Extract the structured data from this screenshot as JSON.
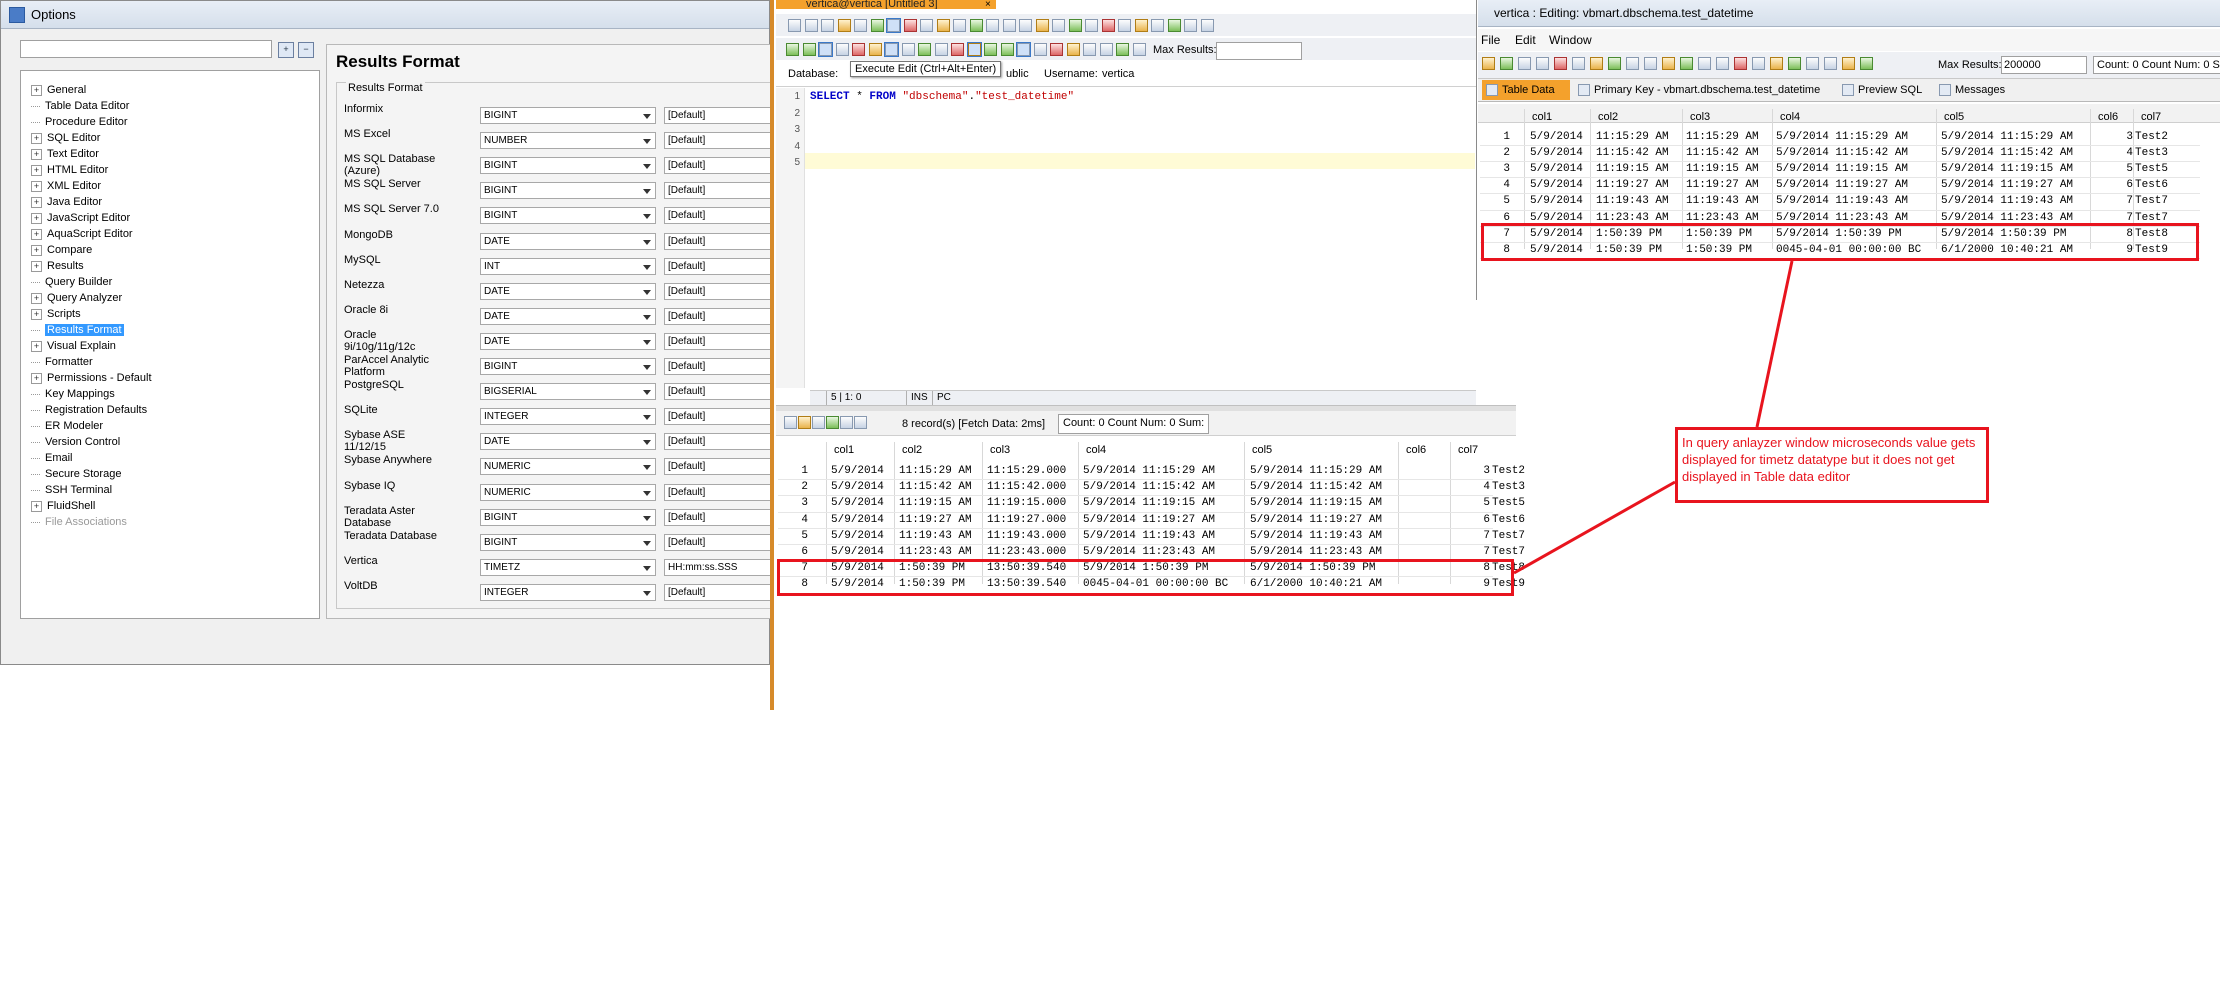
{
  "options_window": {
    "title": "Options",
    "tree": [
      {
        "label": "General",
        "expandable": true
      },
      {
        "label": "Table Data Editor",
        "expandable": false
      },
      {
        "label": "Procedure Editor",
        "expandable": false
      },
      {
        "label": "SQL Editor",
        "expandable": true
      },
      {
        "label": "Text Editor",
        "expandable": true
      },
      {
        "label": "HTML Editor",
        "expandable": true
      },
      {
        "label": "XML Editor",
        "expandable": true
      },
      {
        "label": "Java Editor",
        "expandable": true
      },
      {
        "label": "JavaScript Editor",
        "expandable": true
      },
      {
        "label": "AquaScript Editor",
        "expandable": true
      },
      {
        "label": "Compare",
        "expandable": true
      },
      {
        "label": "Results",
        "expandable": true
      },
      {
        "label": "Query Builder",
        "expandable": false
      },
      {
        "label": "Query Analyzer",
        "expandable": true
      },
      {
        "label": "Scripts",
        "expandable": true
      },
      {
        "label": "Results Format",
        "expandable": false,
        "selected": true
      },
      {
        "label": "Visual Explain",
        "expandable": true
      },
      {
        "label": "Formatter",
        "expandable": false
      },
      {
        "label": "Permissions - Default",
        "expandable": true
      },
      {
        "label": "Key Mappings",
        "expandable": false
      },
      {
        "label": "Registration Defaults",
        "expandable": false
      },
      {
        "label": "ER Modeler",
        "expandable": false
      },
      {
        "label": "Version Control",
        "expandable": false
      },
      {
        "label": "Email",
        "expandable": false
      },
      {
        "label": "Secure Storage",
        "expandable": false
      },
      {
        "label": "SSH Terminal",
        "expandable": false
      },
      {
        "label": "FluidShell",
        "expandable": true
      },
      {
        "label": "File Associations",
        "expandable": false,
        "disabled": true
      }
    ],
    "panel_title": "Results Format",
    "group_label": "Results Format",
    "rows": [
      {
        "name": "Informix",
        "type": "BIGINT",
        "format": "[Default]"
      },
      {
        "name": "MS Excel",
        "type": "NUMBER",
        "format": "[Default]"
      },
      {
        "name": "MS SQL Database (Azure)",
        "type": "BIGINT",
        "format": "[Default]"
      },
      {
        "name": "MS SQL Server",
        "type": "BIGINT",
        "format": "[Default]"
      },
      {
        "name": "MS SQL Server 7.0",
        "type": "BIGINT",
        "format": "[Default]"
      },
      {
        "name": "MongoDB",
        "type": "DATE",
        "format": "[Default]"
      },
      {
        "name": "MySQL",
        "type": "INT",
        "format": "[Default]"
      },
      {
        "name": "Netezza",
        "type": "DATE",
        "format": "[Default]"
      },
      {
        "name": "Oracle 8i",
        "type": "DATE",
        "format": "[Default]"
      },
      {
        "name": "Oracle 9i/10g/11g/12c",
        "type": "DATE",
        "format": "[Default]"
      },
      {
        "name": "ParAccel Analytic Platform",
        "type": "BIGINT",
        "format": "[Default]"
      },
      {
        "name": "PostgreSQL",
        "type": "BIGSERIAL",
        "format": "[Default]"
      },
      {
        "name": "SQLite",
        "type": "INTEGER",
        "format": "[Default]"
      },
      {
        "name": "Sybase ASE 11/12/15",
        "type": "DATE",
        "format": "[Default]"
      },
      {
        "name": "Sybase Anywhere",
        "type": "NUMERIC",
        "format": "[Default]"
      },
      {
        "name": "Sybase IQ",
        "type": "NUMERIC",
        "format": "[Default]"
      },
      {
        "name": "Teradata Aster Database",
        "type": "BIGINT",
        "format": "[Default]"
      },
      {
        "name": "Teradata Database",
        "type": "BIGINT",
        "format": "[Default]"
      },
      {
        "name": "Vertica",
        "type": "TIMETZ",
        "format": "HH:mm:ss.SSS"
      },
      {
        "name": "VoltDB",
        "type": "INTEGER",
        "format": "[Default]"
      }
    ]
  },
  "query_analyzer": {
    "title": "vertica@vertica [Untitled 3]",
    "close": "×",
    "max_results_label": "Max Results:",
    "database_label": "Database:",
    "tooltip": "Execute Edit (Ctrl+Alt+Enter)",
    "schema_partial": "ublic",
    "username_label": "Username:",
    "username": "vertica",
    "line_numbers": [
      "1",
      "2",
      "3",
      "4",
      "5"
    ],
    "sql": {
      "kw1": "SELECT",
      "star": " * ",
      "kw2": "FROM",
      "space": " ",
      "schema": "\"dbschema\"",
      "dot": ".",
      "table": "\"test_datetime\""
    },
    "status": {
      "pos": "5 | 1: 0",
      "ins": "INS",
      "pc": "PC"
    },
    "records": "8 record(s) [Fetch Data: 2ms]",
    "count_box": "Count: 0  Count Num: 0  Sum:",
    "columns": [
      "col1",
      "col2",
      "col3",
      "col4",
      "col5",
      "col6",
      "col7"
    ],
    "rows": [
      [
        "1",
        "5/9/2014",
        "11:15:29 AM",
        "11:15:29.000",
        "5/9/2014 11:15:29 AM",
        "5/9/2014 11:15:29 AM",
        "3",
        "Test2"
      ],
      [
        "2",
        "5/9/2014",
        "11:15:42 AM",
        "11:15:42.000",
        "5/9/2014 11:15:42 AM",
        "5/9/2014 11:15:42 AM",
        "4",
        "Test3"
      ],
      [
        "3",
        "5/9/2014",
        "11:19:15 AM",
        "11:19:15.000",
        "5/9/2014 11:19:15 AM",
        "5/9/2014 11:19:15 AM",
        "5",
        "Test5"
      ],
      [
        "4",
        "5/9/2014",
        "11:19:27 AM",
        "11:19:27.000",
        "5/9/2014 11:19:27 AM",
        "5/9/2014 11:19:27 AM",
        "6",
        "Test6"
      ],
      [
        "5",
        "5/9/2014",
        "11:19:43 AM",
        "11:19:43.000",
        "5/9/2014 11:19:43 AM",
        "5/9/2014 11:19:43 AM",
        "7",
        "Test7"
      ],
      [
        "6",
        "5/9/2014",
        "11:23:43 AM",
        "11:23:43.000",
        "5/9/2014 11:23:43 AM",
        "5/9/2014 11:23:43 AM",
        "7",
        "Test7"
      ],
      [
        "7",
        "5/9/2014",
        "1:50:39 PM",
        "13:50:39.540",
        "5/9/2014 1:50:39 PM",
        "5/9/2014 1:50:39 PM",
        "8",
        "Test8"
      ],
      [
        "8",
        "5/9/2014",
        "1:50:39 PM",
        "13:50:39.540",
        "0045-04-01 00:00:00 BC",
        "6/1/2000 10:40:21 AM",
        "9",
        "Test9"
      ]
    ]
  },
  "table_editor": {
    "title": "vertica : Editing: vbmart.dbschema.test_datetime",
    "menu": [
      "File",
      "Edit",
      "Window"
    ],
    "max_results_label": "Max Results:",
    "max_results": "200000",
    "count_box": "Count: 0  Count Num: 0  S",
    "tabs": [
      "Table Data",
      "Primary Key - vbmart.dbschema.test_datetime",
      "Preview SQL",
      "Messages"
    ],
    "columns": [
      "col1",
      "col2",
      "col3",
      "col4",
      "col5",
      "col6",
      "col7"
    ],
    "rows": [
      [
        "1",
        "5/9/2014",
        "11:15:29 AM",
        "11:15:29 AM",
        "5/9/2014 11:15:29 AM",
        "5/9/2014 11:15:29 AM",
        "3",
        "Test2"
      ],
      [
        "2",
        "5/9/2014",
        "11:15:42 AM",
        "11:15:42 AM",
        "5/9/2014 11:15:42 AM",
        "5/9/2014 11:15:42 AM",
        "4",
        "Test3"
      ],
      [
        "3",
        "5/9/2014",
        "11:19:15 AM",
        "11:19:15 AM",
        "5/9/2014 11:19:15 AM",
        "5/9/2014 11:19:15 AM",
        "5",
        "Test5"
      ],
      [
        "4",
        "5/9/2014",
        "11:19:27 AM",
        "11:19:27 AM",
        "5/9/2014 11:19:27 AM",
        "5/9/2014 11:19:27 AM",
        "6",
        "Test6"
      ],
      [
        "5",
        "5/9/2014",
        "11:19:43 AM",
        "11:19:43 AM",
        "5/9/2014 11:19:43 AM",
        "5/9/2014 11:19:43 AM",
        "7",
        "Test7"
      ],
      [
        "6",
        "5/9/2014",
        "11:23:43 AM",
        "11:23:43 AM",
        "5/9/2014 11:23:43 AM",
        "5/9/2014 11:23:43 AM",
        "7",
        "Test7"
      ],
      [
        "7",
        "5/9/2014",
        "1:50:39 PM",
        "1:50:39 PM",
        "5/9/2014 1:50:39 PM",
        "5/9/2014 1:50:39 PM",
        "8",
        "Test8"
      ],
      [
        "8",
        "5/9/2014",
        "1:50:39 PM",
        "1:50:39 PM",
        "0045-04-01 00:00:00 BC",
        "6/1/2000 10:40:21 AM",
        "9",
        "Test9"
      ]
    ]
  },
  "annotation": {
    "note": "In query anlayzer window microseconds value gets displayed for timetz datatype but it does not get displayed in Table data editor",
    "color": "#e8141e"
  }
}
